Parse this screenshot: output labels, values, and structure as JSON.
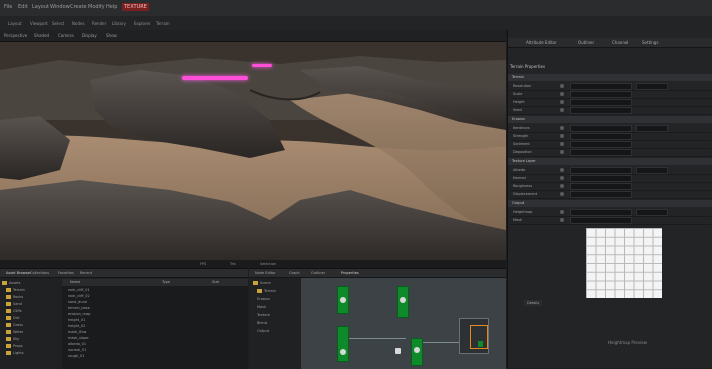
{
  "menubar": {
    "items": [
      "File",
      "Edit",
      "Layout",
      "Window",
      "Create",
      "Modify",
      "Help"
    ],
    "badge": "TEXTURE"
  },
  "toolbar": {
    "items": [
      "Layout",
      "Viewport",
      "Select",
      "Nodes",
      "Render",
      "Library",
      "Explorer",
      "Terrain"
    ]
  },
  "viewport": {
    "header": [
      "Perspective",
      "Shaded",
      "Camera",
      "Display",
      "Show"
    ],
    "status": [
      "FPS",
      "Tris",
      "Selection"
    ]
  },
  "right_panel": {
    "tabs": [
      "Attribute Editor",
      "Outliner",
      "Channel",
      "Settings"
    ],
    "header": "Terrain Properties",
    "sections": [
      {
        "title": "Terrain",
        "rows": [
          "Resolution",
          "Scale",
          "Height",
          "Seed"
        ]
      },
      {
        "title": "Erosion",
        "rows": [
          "Iterations",
          "Strength",
          "Sediment",
          "Deposition"
        ]
      },
      {
        "title": "Texture Layer",
        "rows": [
          "Albedo",
          "Normal",
          "Roughness",
          "Displacement"
        ]
      },
      {
        "title": "Output",
        "rows": [
          "Heightmap",
          "Mask"
        ]
      }
    ],
    "preview_label": "Heightmap Preview",
    "bottom_tab": "Details"
  },
  "asset_browser": {
    "tabs": [
      "Asset Browser",
      "Collections",
      "Favorites",
      "Recent"
    ],
    "folders": [
      "Assets",
      "Terrain",
      "Rocks",
      "Sand",
      "Cliffs",
      "Dirt",
      "Grass",
      "Water",
      "Sky",
      "Props",
      "Lights"
    ],
    "columns": [
      "Name",
      "Type",
      "Size"
    ],
    "files": [
      "rock_cliff_01",
      "rock_cliff_02",
      "sand_dune",
      "terrain_base",
      "erosion_map",
      "height_01",
      "height_02",
      "mask_flow",
      "mask_slope",
      "albedo_01",
      "normal_01",
      "rough_01"
    ]
  },
  "node_editor": {
    "tabs": [
      "Node Editor",
      "Graph",
      "Outliner",
      "Properties"
    ],
    "tree": [
      "Scene",
      "Terrain",
      "Erosion",
      "Mask",
      "Texture",
      "Blend",
      "Output"
    ]
  },
  "colors": {
    "accent": "#c9a23a",
    "node_green": "#0e8a2a",
    "highlight_pink": "#ff4fd8"
  }
}
